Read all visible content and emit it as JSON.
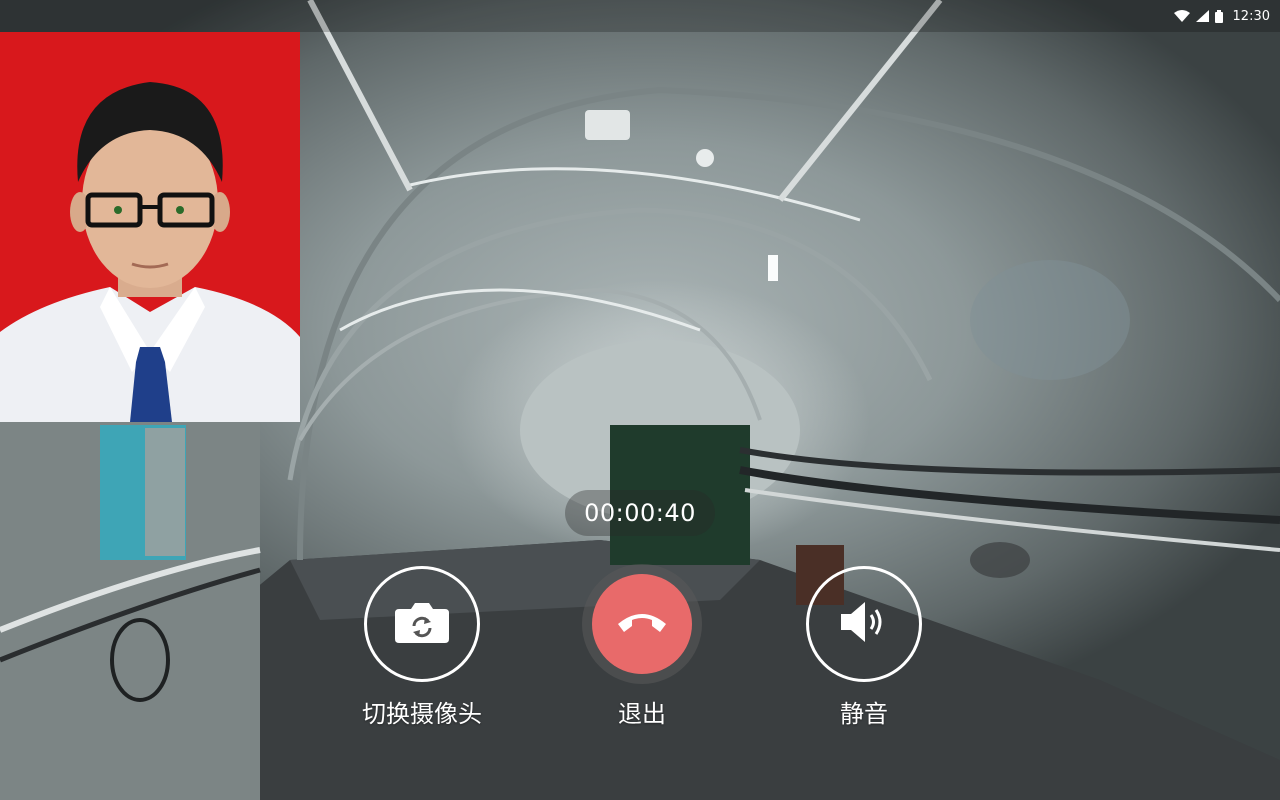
{
  "status_bar": {
    "time": "12:30",
    "icons": [
      "wifi-icon",
      "signal-icon",
      "battery-icon"
    ]
  },
  "call": {
    "timer": "00:00:40"
  },
  "controls": {
    "switch_camera": {
      "label": "切换摄像头",
      "icon": "camera-switch-icon"
    },
    "hangup": {
      "label": "退出",
      "icon": "phone-hangup-icon",
      "color": "#e86a6a"
    },
    "mute": {
      "label": "静音",
      "icon": "speaker-icon"
    }
  },
  "colors": {
    "hangup_red": "#e86a6a",
    "preview_background": "#d8181c",
    "control_ring": "#ffffff"
  }
}
